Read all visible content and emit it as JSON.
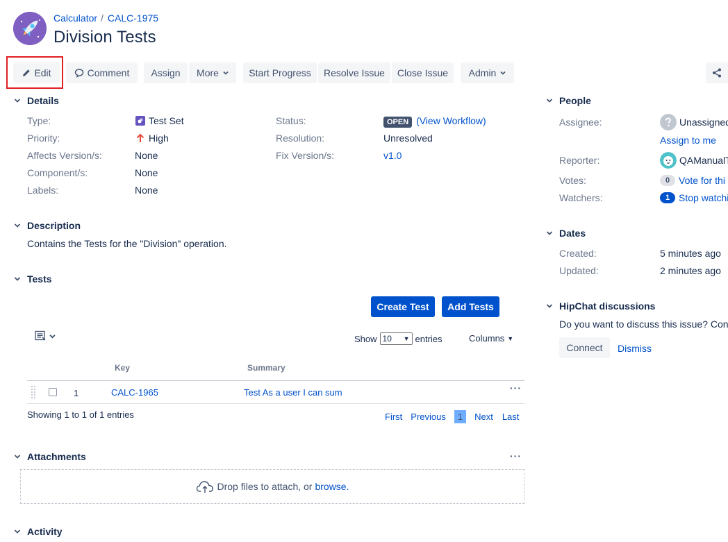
{
  "breadcrumb": {
    "project": "Calculator",
    "separator": "/",
    "issue_key": "CALC-1975"
  },
  "issue": {
    "title": "Division Tests"
  },
  "toolbar": {
    "edit": "Edit",
    "comment": "Comment",
    "assign": "Assign",
    "more": "More",
    "start_progress": "Start Progress",
    "resolve_issue": "Resolve Issue",
    "close_issue": "Close Issue",
    "admin": "Admin"
  },
  "details": {
    "heading": "Details",
    "type_label": "Type:",
    "type_value": "Test Set",
    "priority_label": "Priority:",
    "priority_value": "High",
    "affects_label": "Affects Version/s:",
    "affects_value": "None",
    "component_label": "Component/s:",
    "component_value": "None",
    "labels_label": "Labels:",
    "labels_value": "None",
    "status_label": "Status:",
    "status_value": "OPEN",
    "workflow_link": "(View Workflow)",
    "resolution_label": "Resolution:",
    "resolution_value": "Unresolved",
    "fix_label": "Fix Version/s:",
    "fix_value": "v1.0"
  },
  "description": {
    "heading": "Description",
    "text": "Contains the Tests for the \"Division\" operation."
  },
  "tests": {
    "heading": "Tests",
    "create_button": "Create Test",
    "add_button": "Add Tests",
    "show_label": "Show",
    "show_value": "10",
    "entries_label": "entries",
    "columns_label": "Columns",
    "columns": {
      "key": "Key",
      "summary": "Summary"
    },
    "rows": [
      {
        "rank": "1",
        "key": "CALC-1965",
        "summary": "Test As a user I can sum"
      }
    ],
    "showing": "Showing 1 to 1 of 1 entries",
    "pager": {
      "first": "First",
      "previous": "Previous",
      "current": "1",
      "next": "Next",
      "last": "Last"
    }
  },
  "attachments": {
    "heading": "Attachments",
    "drop_text": "Drop files to attach, or",
    "browse": "browse."
  },
  "activity": {
    "heading": "Activity"
  },
  "people": {
    "heading": "People",
    "assignee_label": "Assignee:",
    "assignee_value": "Unassigned",
    "assign_to_me": "Assign to me",
    "reporter_label": "Reporter:",
    "reporter_value": "QAManualT",
    "votes_label": "Votes:",
    "votes_count": "0",
    "votes_link": "Vote for thi",
    "watchers_label": "Watchers:",
    "watchers_count": "1",
    "watchers_link": "Stop watchi"
  },
  "dates": {
    "heading": "Dates",
    "created_label": "Created:",
    "created_value": "5 minutes ago",
    "updated_label": "Updated:",
    "updated_value": "2 minutes ago"
  },
  "hipchat": {
    "heading": "HipChat discussions",
    "prompt": "Do you want to discuss this issue? Conn",
    "connect": "Connect",
    "dismiss": "Dismiss"
  },
  "colors": {
    "accent": "#0052cc",
    "highlight": "#e01e23",
    "avatar": "#7f5fc2",
    "priority_high": "#e5493a"
  },
  "icons": [
    "rocket-icon",
    "pencil-icon",
    "comment-icon",
    "share-icon",
    "test-set-icon",
    "arrow-up-icon",
    "chevron-down-icon",
    "list-view-icon",
    "drag-handle-icon",
    "more-icon",
    "cloud-upload-icon",
    "unknown-user-icon",
    "user-avatar-icon"
  ]
}
